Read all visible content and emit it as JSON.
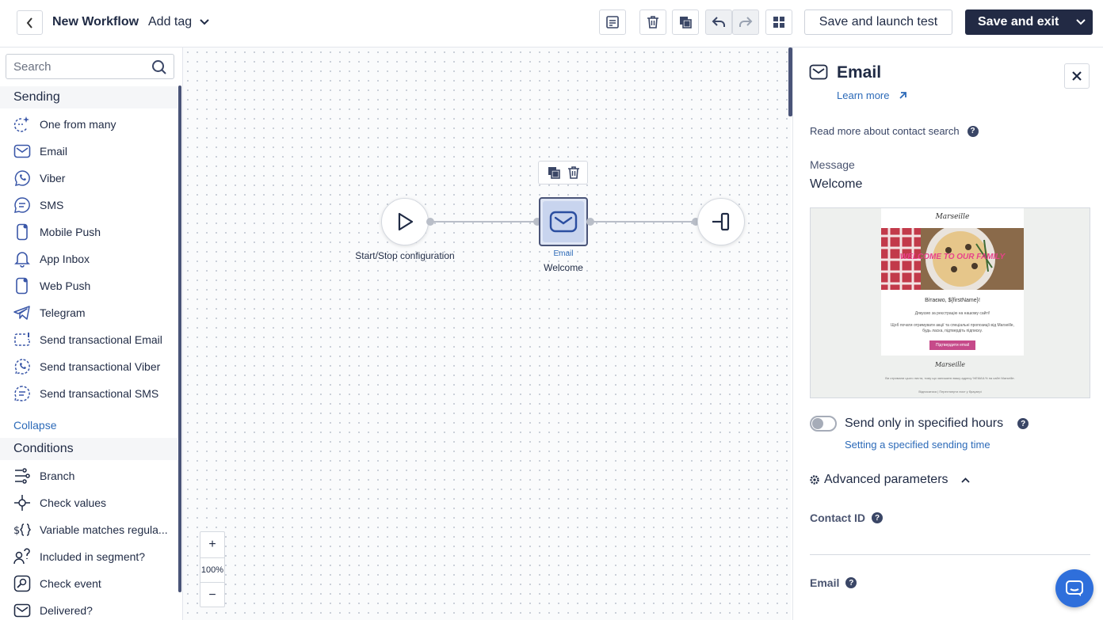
{
  "header": {
    "title": "New Workflow",
    "add_tag": "Add tag",
    "save_launch_test": "Save and launch test",
    "save_exit": "Save and exit"
  },
  "sidebar": {
    "search_placeholder": "Search",
    "sections": {
      "sending": "Sending",
      "conditions": "Conditions"
    },
    "sending_items": [
      {
        "label": "One from many",
        "icon": "sparkle-chat-icon"
      },
      {
        "label": "Email",
        "icon": "envelope-icon"
      },
      {
        "label": "Viber",
        "icon": "viber-icon"
      },
      {
        "label": "SMS",
        "icon": "sms-bubble-icon"
      },
      {
        "label": "Mobile Push",
        "icon": "mobile-icon"
      },
      {
        "label": "App Inbox",
        "icon": "bell-icon"
      },
      {
        "label": "Web Push",
        "icon": "web-push-icon"
      },
      {
        "label": "Telegram",
        "icon": "telegram-icon"
      },
      {
        "label": "Send transactional Email",
        "icon": "transactional-email-icon"
      },
      {
        "label": "Send transactional Viber",
        "icon": "transactional-viber-icon"
      },
      {
        "label": "Send transactional SMS",
        "icon": "transactional-sms-icon"
      }
    ],
    "collapse": "Collapse",
    "condition_items": [
      {
        "label": "Branch",
        "icon": "branch-icon"
      },
      {
        "label": "Check values",
        "icon": "check-values-icon"
      },
      {
        "label": "Variable matches regula...",
        "icon": "variable-icon"
      },
      {
        "label": "Included in segment?",
        "icon": "segment-icon"
      },
      {
        "label": "Check event",
        "icon": "event-icon"
      },
      {
        "label": "Delivered?",
        "icon": "delivered-icon"
      }
    ]
  },
  "canvas": {
    "zoom_in": "+",
    "zoom_level": "100%",
    "zoom_out": "−",
    "start_label": "Start/Stop configuration",
    "email_node_type": "Email",
    "email_node_name": "Welcome"
  },
  "panel": {
    "title": "Email",
    "learn_more": "Learn more",
    "read_more": "Read more about contact search",
    "message_label": "Message",
    "message_value": "Welcome",
    "preview": {
      "logo": "Marseille",
      "banner": "WELCOME TO OUR FAMILY",
      "greeting": "Вітаємо, ${firstName}!",
      "line1": "Дякуємо за реєстрацію на нашому сайті!",
      "line2": "Щоб почати отримувати акції та спеціальні пропозиції від Marseille, будь ласка, підтвердіть підписку.",
      "button": "Підтвердити email",
      "footer_logo": "Marseille",
      "footer1": "Ви отримали цього листа, тому що залишили вашу адресу %EMAIL% на сайті Marseille.",
      "footer2": "Відписатися | Переглянути лист у браузері"
    },
    "send_hours": "Send only in specified hours",
    "sending_time_link": "Setting a specified sending time",
    "advanced": "Advanced parameters",
    "contact_id": "Contact ID",
    "email_field": "Email"
  },
  "colors": {
    "primary": "#222a44",
    "link": "#2c6ab8",
    "icon_blue": "#3a57a8",
    "chat": "#2f6fdb"
  }
}
